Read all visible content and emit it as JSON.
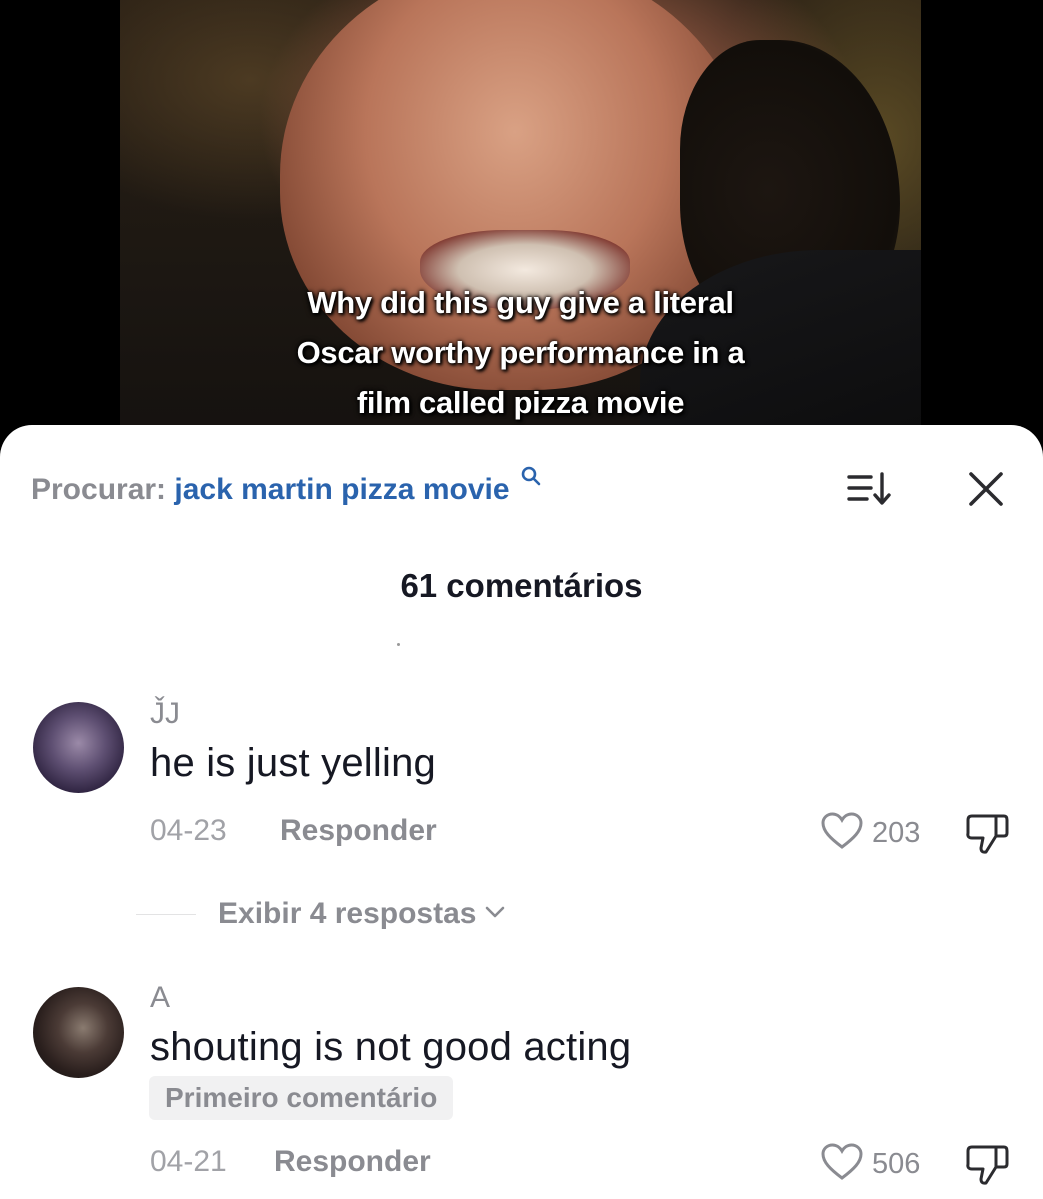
{
  "video": {
    "caption_lines": [
      "Why did this guy give a literal",
      "Oscar worthy performance in a",
      "film called pizza movie"
    ]
  },
  "search": {
    "prefix": "Procurar:",
    "query": "jack martin pizza movie"
  },
  "comments_header": {
    "count_label": "61 comentários"
  },
  "comments": [
    {
      "username": "J̌J",
      "text": "he is just yelling",
      "date": "04-23",
      "reply_label": "Responder",
      "likes": "203",
      "view_replies": "Exibir 4 respostas"
    },
    {
      "username": "A",
      "text": "shouting is not good acting",
      "badge": "Primeiro comentário",
      "date": "04-21",
      "reply_label": "Responder",
      "likes": "506"
    }
  ],
  "icons": {
    "search": "search-icon",
    "sort": "sort-icon",
    "close": "close-icon",
    "like": "heart-icon",
    "dislike": "thumbs-down-icon",
    "expand": "chevron-down-icon"
  },
  "colors": {
    "search_query": "#2a63ad",
    "secondary_text": "#8a8b91",
    "primary_text": "#161823"
  }
}
